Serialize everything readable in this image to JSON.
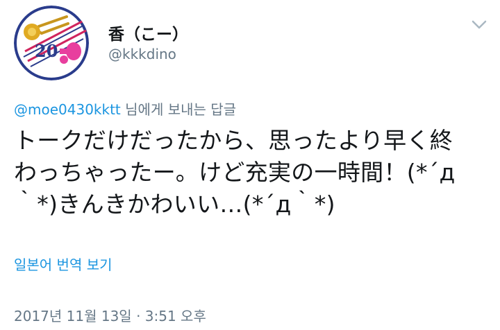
{
  "tweet": {
    "author": {
      "display_name": "香（こー）",
      "handle": "@kkkdino",
      "avatar_badge": "20"
    },
    "reply_to": {
      "mention": "@moe0430kktt",
      "suffix": " 님에게 보내는 답글"
    },
    "text_lines": [
      "トークだけだったから、思ったより早く終",
      "わっちゃったー。けど充実の一時間！(*´д",
      "｀*)きんきかわいい…(*´д｀*)"
    ],
    "translate_label": "일본어 번역 보기",
    "timestamp": "2017년 11월 13일 · 3:51 오후"
  },
  "icons": {
    "menu": "chevron-down-icon"
  },
  "colors": {
    "link": "#1b95e0",
    "secondary_text": "#657786",
    "primary_text": "#14171a",
    "avatar_ring": "#2a3c8c",
    "avatar_accent": "#d0245e"
  }
}
